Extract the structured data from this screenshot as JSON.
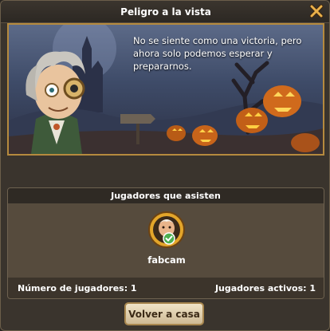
{
  "dialog": {
    "title": "Peligro a la vista",
    "close_icon": "close-icon"
  },
  "scene": {
    "story_text": "No se siente como una victoria, pero ahora solo podemos esperar y prepararnos.",
    "character_icon": "old-scientist-portrait",
    "background": "haunted-castle-pumpkin-field"
  },
  "players_panel": {
    "header": "Jugadores que asisten",
    "players": [
      {
        "name": "fabcam",
        "avatar_icon": "bearded-player-avatar-icon",
        "status_icon": "checkmark-icon"
      }
    ],
    "count_label": "Número de jugadores: 1",
    "active_label": "Jugadores activos: 1"
  },
  "actions": {
    "home_button": "Volver a casa"
  },
  "colors": {
    "frame_gold": "#b58a3e",
    "panel_bg": "#564b3d",
    "button_bg": "#e3d4b4",
    "check_green": "#4caf50"
  }
}
